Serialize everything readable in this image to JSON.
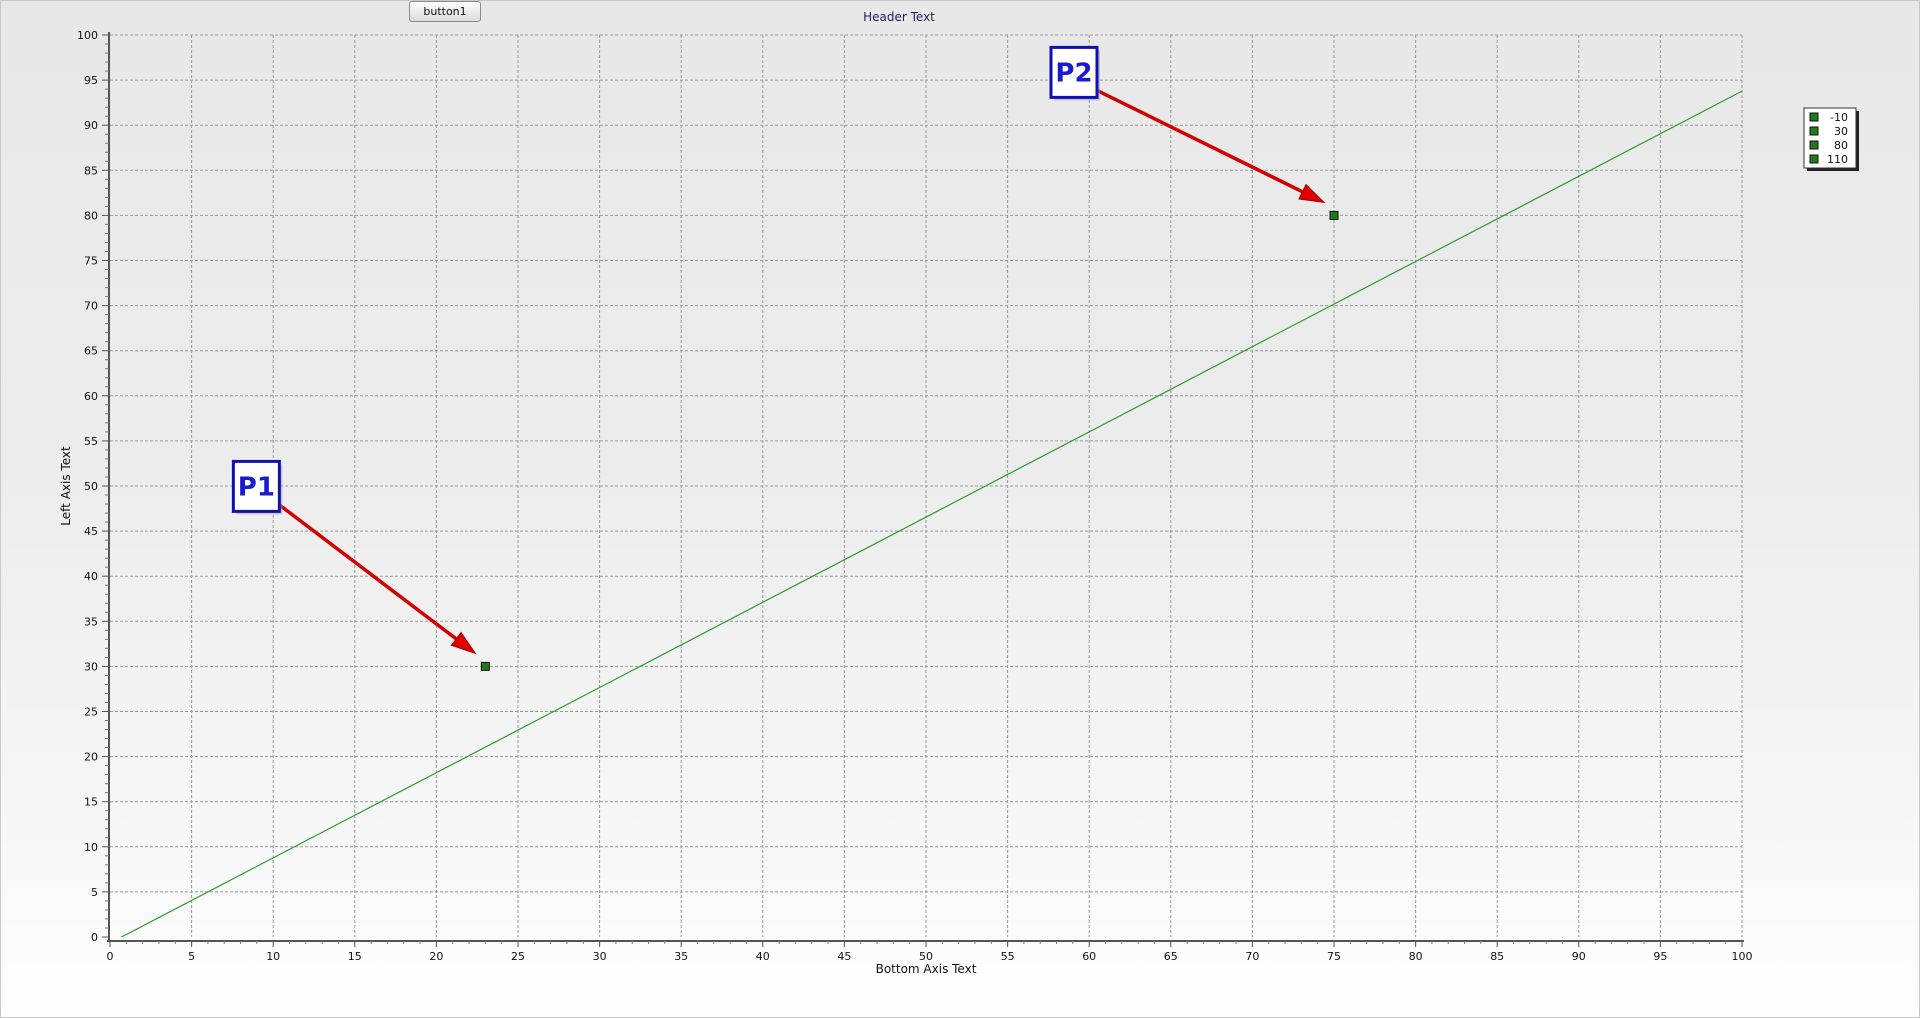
{
  "button": {
    "label": "button1"
  },
  "header": {
    "title": "Header Text"
  },
  "chart_data": {
    "type": "line",
    "title": "Header Text",
    "xlabel": "Bottom Axis Text",
    "ylabel": "Left Axis Text",
    "xlim": [
      0,
      100
    ],
    "ylim": [
      0,
      100
    ],
    "x_ticks": [
      0,
      5,
      10,
      15,
      20,
      25,
      30,
      35,
      40,
      45,
      50,
      55,
      60,
      65,
      70,
      75,
      80,
      85,
      90,
      95,
      100
    ],
    "y_ticks": [
      0,
      5,
      10,
      15,
      20,
      25,
      30,
      35,
      40,
      45,
      50,
      55,
      60,
      65,
      70,
      75,
      80,
      85,
      90,
      95,
      100
    ],
    "grid": true,
    "series": [
      {
        "color": "#2e9a2e",
        "x": [
          -10,
          30,
          80,
          110
        ],
        "y": [
          -10.11,
          27.66,
          74.89,
          103.22
        ]
      }
    ],
    "points": [
      {
        "x": 23,
        "y": 30
      },
      {
        "x": 75,
        "y": 80
      }
    ],
    "annotations": [
      {
        "text": "P1",
        "target_x": 23,
        "target_y": 30
      },
      {
        "text": "P2",
        "target_x": 75,
        "target_y": 80
      }
    ],
    "legend": {
      "entries": [
        "-10",
        "30",
        "80",
        "110"
      ],
      "position": "right",
      "marker_color": "#1f7a1f"
    }
  }
}
